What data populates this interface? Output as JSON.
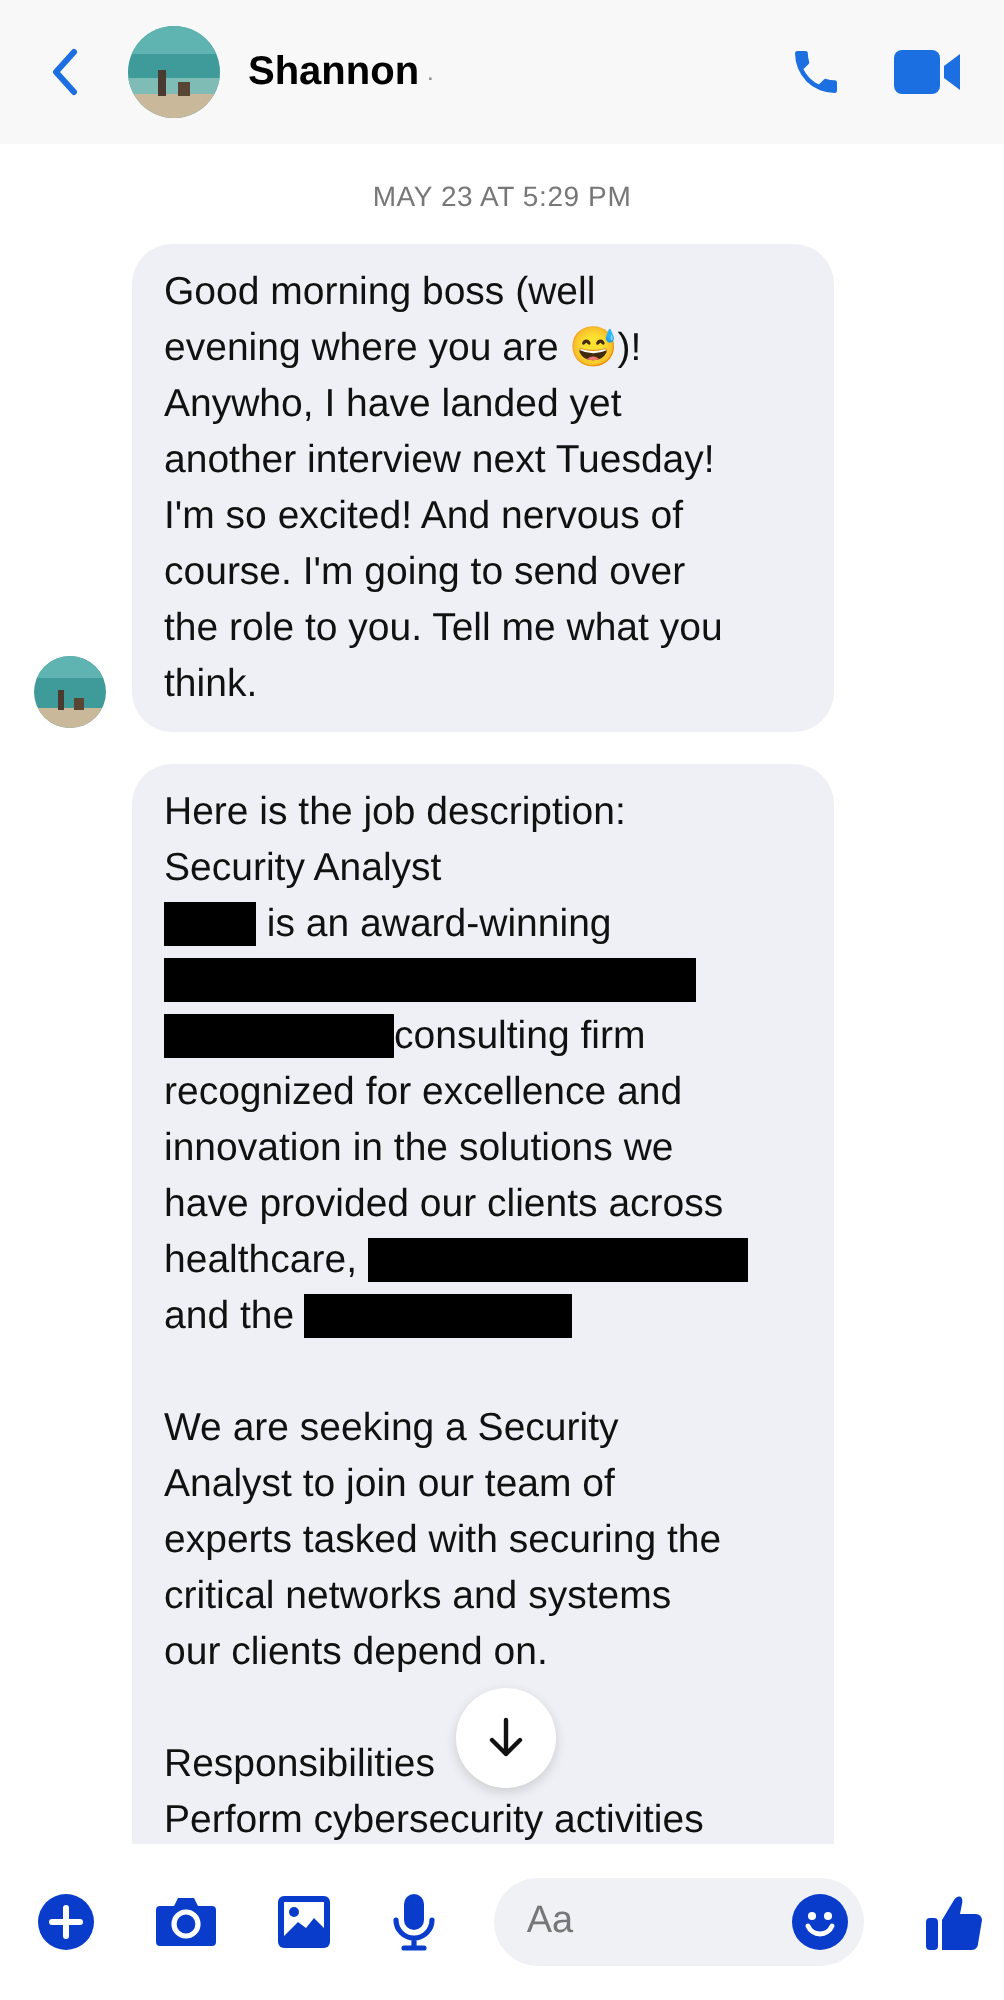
{
  "header": {
    "contact_name": "Shannon",
    "status_mark": "."
  },
  "timestamp": "MAY 23 AT 5:29 PM",
  "messages": [
    {
      "paragraphs": [
        [
          [
            {
              "kind": "text",
              "text": "Good morning boss (well"
            }
          ],
          [
            {
              "kind": "text",
              "text": "evening where you are 😅)!"
            }
          ],
          [
            {
              "kind": "text",
              "text": "Anywho, I have landed yet"
            }
          ],
          [
            {
              "kind": "text",
              "text": "another interview next Tuesday!"
            }
          ],
          [
            {
              "kind": "text",
              "text": "I'm so excited! And nervous of"
            }
          ],
          [
            {
              "kind": "text",
              "text": "course. I'm going to send over"
            }
          ],
          [
            {
              "kind": "text",
              "text": "the role to you. Tell me what you"
            }
          ],
          [
            {
              "kind": "text",
              "text": "think."
            }
          ]
        ]
      ]
    },
    {
      "paragraphs": [
        [
          [
            {
              "kind": "text",
              "text": "Here is the job description:"
            }
          ],
          [
            {
              "kind": "text",
              "text": "Security Analyst"
            }
          ],
          [
            {
              "kind": "redacted"
            },
            {
              "kind": "text",
              "text": " is an award-winning"
            }
          ],
          [
            {
              "kind": "redacted"
            }
          ],
          [
            {
              "kind": "redacted"
            },
            {
              "kind": "text",
              "text": "consulting firm"
            }
          ],
          [
            {
              "kind": "text",
              "text": "recognized for excellence and"
            }
          ],
          [
            {
              "kind": "text",
              "text": "innovation in the solutions we"
            }
          ],
          [
            {
              "kind": "text",
              "text": "have provided our clients across"
            }
          ],
          [
            {
              "kind": "text",
              "text": "healthcare, "
            },
            {
              "kind": "redacted"
            }
          ],
          [
            {
              "kind": "text",
              "text": "and the "
            },
            {
              "kind": "redacted"
            }
          ]
        ],
        [
          [
            {
              "kind": "text",
              "text": "We are seeking a Security"
            }
          ],
          [
            {
              "kind": "text",
              "text": "Analyst to join our team of"
            }
          ],
          [
            {
              "kind": "text",
              "text": "experts tasked with securing the"
            }
          ],
          [
            {
              "kind": "text",
              "text": "critical networks and systems"
            }
          ],
          [
            {
              "kind": "text",
              "text": "our clients depend on."
            }
          ]
        ],
        [
          [
            {
              "kind": "text",
              "text": "Responsibilities"
            }
          ],
          [
            {
              "kind": "text",
              "text": "Perform cybersecurity activities"
            }
          ]
        ]
      ]
    }
  ],
  "composer": {
    "placeholder": "Aa"
  }
}
